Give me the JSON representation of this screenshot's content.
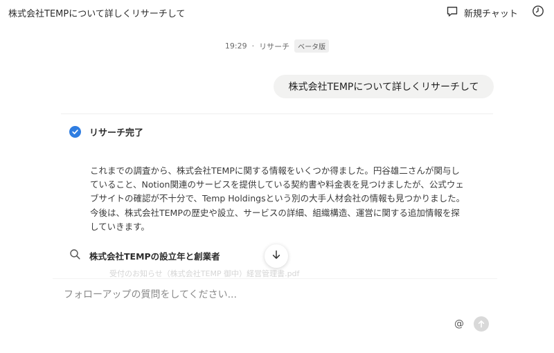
{
  "header": {
    "title": "株式会社TEMPについて詳しくリサーチして",
    "new_chat_label": "新規チャット",
    "new_chat_icon": "chat-bubble-icon",
    "history_icon": "clock-icon"
  },
  "meta": {
    "time": "19:29",
    "separator": "·",
    "mode": "リサーチ",
    "badge": "ベータ版"
  },
  "user_message": "株式会社TEMPについて詳しくリサーチして",
  "research": {
    "status_label": "リサーチ完了",
    "status_icon": "check-circle-icon",
    "status_color": "#2f7de1",
    "summary": "これまでの調査から、株式会社TEMPに関する情報をいくつか得ました。円谷雄二さんが関与していること、Notion関連のサービスを提供している契約書や料金表を見つけましたが、公式ウェブサイトの確認が不十分で、Temp Holdingsという別の大手人材会社の情報も見つかりました。今後は、株式会社TEMPの歴史や設立、サービスの詳細、組織構造、運営に関する追加情報を探していきます。",
    "search_query": "株式会社TEMPの設立年と創業者",
    "search_icon": "search-icon",
    "faded_result": "受付のお知らせ（株式会社TEMP 御中）経営管理書.pdf"
  },
  "composer": {
    "placeholder": "フォローアップの質問をしてください...",
    "mention_symbol": "@",
    "send_icon": "arrow-up-icon",
    "scroll_icon": "arrow-down-icon"
  }
}
